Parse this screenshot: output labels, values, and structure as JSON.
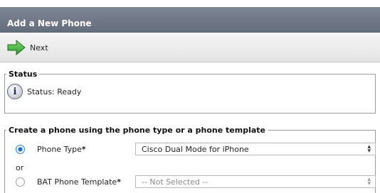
{
  "window": {
    "title": "Add a New Phone"
  },
  "toolbar": {
    "next_label": "Next",
    "next_icon": "arrow-right-icon"
  },
  "status": {
    "legend": "Status",
    "text": "Status: Ready",
    "icon": "info-icon"
  },
  "create": {
    "legend": "Create a phone using the phone type or a phone template",
    "phone_type_label": "Phone Type",
    "phone_type_required": "*",
    "phone_type_value": "Cisco Dual Mode for iPhone",
    "phone_type_selected": true,
    "or_label": "or",
    "bat_label": "BAT Phone Template",
    "bat_required": "*",
    "bat_value": "-- Not Selected --",
    "bat_selected": false
  },
  "colors": {
    "title_bar": "#6f7787",
    "accent_green": "#3aa63a",
    "radio_selected": "#1f6fd0"
  }
}
